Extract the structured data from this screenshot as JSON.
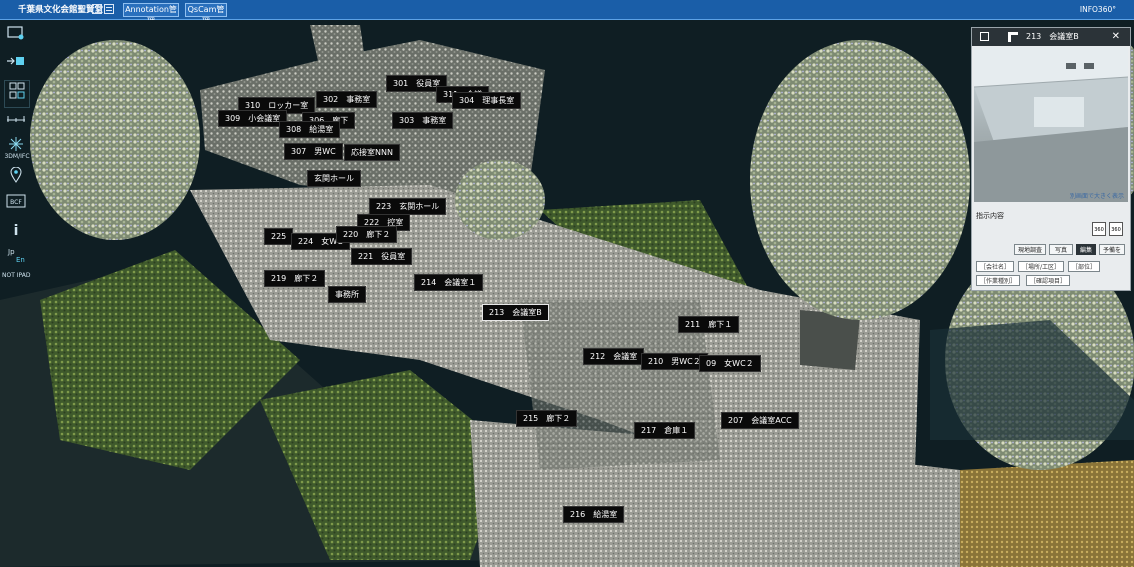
{
  "header": {
    "title": "千葉県文化会館聖賢堂",
    "nav_annotation": "Annotation管理",
    "nav_qscam": "QsCam管理",
    "info": "INFO360°"
  },
  "toolbar": {
    "label_3dm": "3DM/IFC",
    "lang_jp": "Jp",
    "lang_en": "En",
    "status": "NOT IPAD"
  },
  "rooms": [
    {
      "id": "301",
      "text": "301　役員室"
    },
    {
      "id": "311",
      "text": "311　会議"
    },
    {
      "id": "304",
      "text": "304　理事長室"
    },
    {
      "id": "302",
      "text": "302　事務室"
    },
    {
      "id": "310",
      "text": "310　ロッカー室"
    },
    {
      "id": "309",
      "text": "309　小会議室"
    },
    {
      "id": "306",
      "text": "306　廊下"
    },
    {
      "id": "303",
      "text": "303　事務室"
    },
    {
      "id": "308",
      "text": "308　給湯室"
    },
    {
      "id": "307",
      "text": "307　男WC"
    },
    {
      "id": "osetsu",
      "text": "応接室NNN"
    },
    {
      "id": "genkan1",
      "text": "玄関ホール"
    },
    {
      "id": "223",
      "text": "223　玄関ホール"
    },
    {
      "id": "222",
      "text": "222　控室"
    },
    {
      "id": "225",
      "text": "225"
    },
    {
      "id": "224",
      "text": "224　女WC"
    },
    {
      "id": "220",
      "text": "220　廊下２"
    },
    {
      "id": "221",
      "text": "221　役員室"
    },
    {
      "id": "219",
      "text": "219　廊下２"
    },
    {
      "id": "jimusho",
      "text": "事務所"
    },
    {
      "id": "214",
      "text": "214　会議室１"
    },
    {
      "id": "213",
      "text": "213　会議室B"
    },
    {
      "id": "211",
      "text": "211　廊下１"
    },
    {
      "id": "212",
      "text": "212　会議室"
    },
    {
      "id": "210",
      "text": "210　男WC２"
    },
    {
      "id": "209",
      "text": "09　女WC２"
    },
    {
      "id": "215",
      "text": "215　廊下２"
    },
    {
      "id": "207",
      "text": "207　会議室ACC"
    },
    {
      "id": "217",
      "text": "217　倉庫１"
    },
    {
      "id": "216",
      "text": "216　給湯室"
    }
  ],
  "panel": {
    "title": "213　会議室B",
    "photo_hint": "別画面で大きく表示",
    "section": "指示内容",
    "btn_genba": "現地調査",
    "btn_shashin": "写真",
    "btn_edit": "編集",
    "btn_yotei": "予備を",
    "tag_company": "［会社名］",
    "tag_place": "［場所/工区］",
    "tag_dept": "［部位］",
    "tag_work": "［作業種別］",
    "tag_item": "［確認項目］",
    "badge_a": "360",
    "badge_b": "360"
  }
}
